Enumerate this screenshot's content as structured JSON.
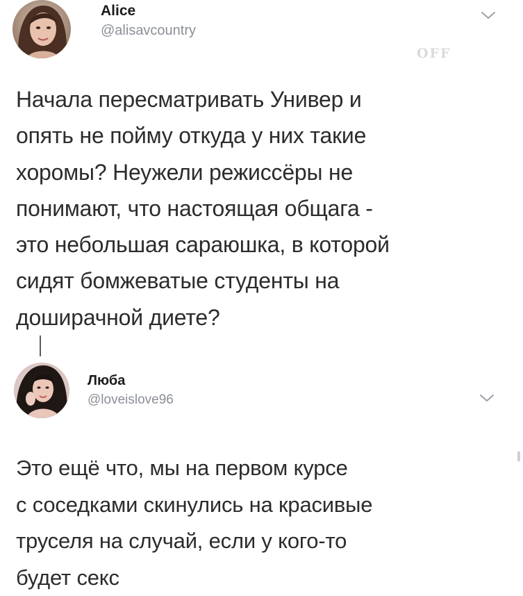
{
  "watermark": "OFF",
  "tweets": [
    {
      "name": "Alice",
      "handle": "@alisavcountry",
      "avatar": "woman-portrait-avatar",
      "menu_icon": "chevron-down-icon",
      "lines": [
        "Начала пересматривать Универ и",
        "опять не пойму откуда у них такие",
        "хоромы? Неужели режиссёры не",
        "понимают, что настоящая общага -",
        "это небольшая сараюшка, в которой",
        "сидят бомжеватые студенты на",
        "доширачной диете?"
      ]
    },
    {
      "name": "Люба",
      "handle": "@loveislove96",
      "avatar": "woman-portrait-avatar",
      "menu_icon": "chevron-down-icon",
      "lines": [
        "Это ещё что, мы на первом курсе",
        "с соседками скинулись на красивые",
        "труселя на случай, если у кого-то",
        "будет секс"
      ]
    }
  ],
  "colors": {
    "text": "#2c2c2c",
    "handle": "#8a8f96",
    "chevron": "#9aa0a6",
    "thread_line": "#5a5a5a"
  }
}
